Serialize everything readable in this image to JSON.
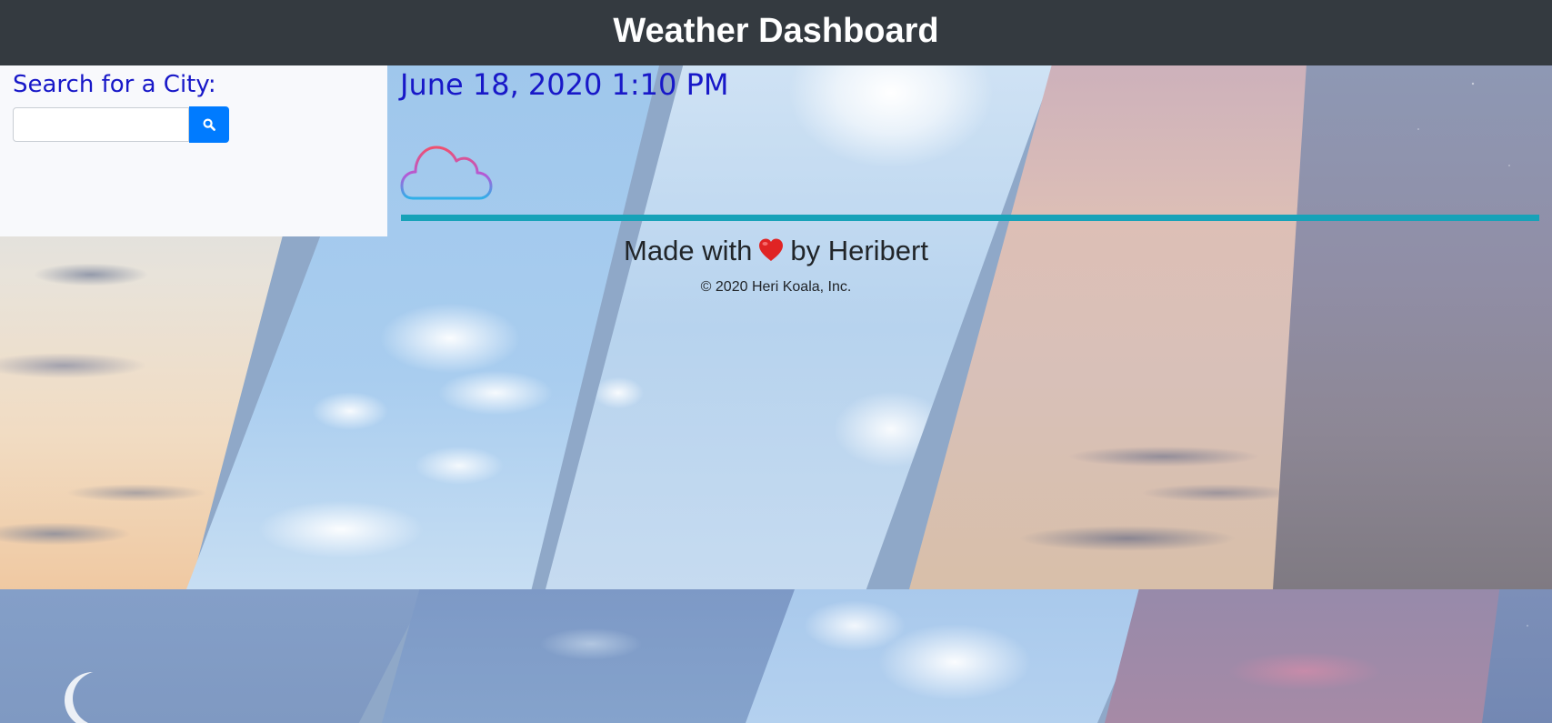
{
  "header": {
    "title": "Weather Dashboard"
  },
  "search": {
    "label": "Search for a City:",
    "input_value": "",
    "placeholder": "",
    "button_icon": "search-icon"
  },
  "today": {
    "datetime": "June 18, 2020 1:10 PM",
    "weather_icon": "cloud-icon"
  },
  "footer": {
    "made_with_prefix": "Made with",
    "heart_icon": "heart-icon",
    "made_with_suffix": "by Heribert",
    "copyright": "© 2020 Heri Koala, Inc."
  },
  "colors": {
    "header_bg": "#343a40",
    "accent_blue": "#007bff",
    "divider_teal": "#17a2b8",
    "label_blue": "#1818c8"
  }
}
